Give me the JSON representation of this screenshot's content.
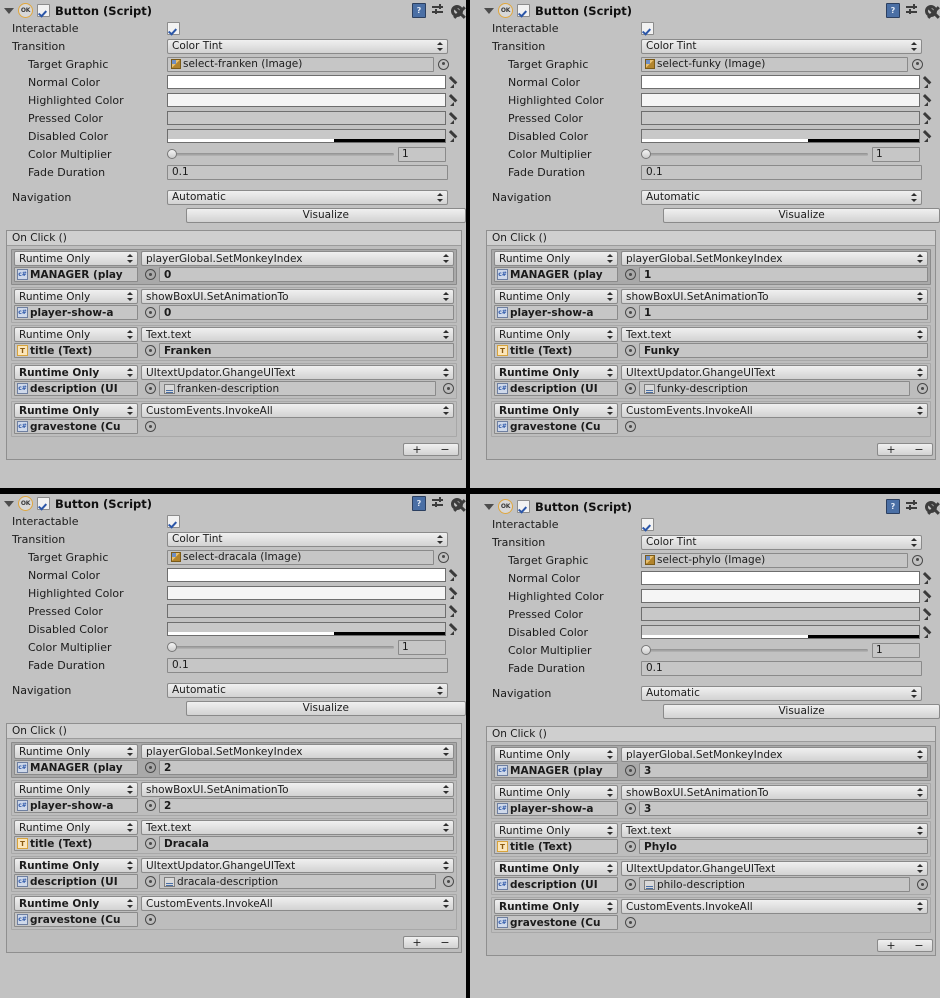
{
  "component": {
    "title": "Button (Script)",
    "badge": "OK",
    "enabled": true,
    "help_icon": "book-help-icon",
    "preset_icon": "preset-icon",
    "gear_icon": "gear-icon"
  },
  "labels": {
    "interactable": "Interactable",
    "transition": "Transition",
    "target_graphic": "Target Graphic",
    "normal_color": "Normal Color",
    "highlighted_color": "Highlighted Color",
    "pressed_color": "Pressed Color",
    "disabled_color": "Disabled Color",
    "color_multiplier": "Color Multiplier",
    "fade_duration": "Fade Duration",
    "navigation": "Navigation",
    "visualize": "Visualize",
    "on_click": "On Click ()",
    "plus": "+",
    "minus": "−"
  },
  "common": {
    "transition_value": "Color Tint",
    "navigation_value": "Automatic",
    "color_multiplier_value": "1",
    "fade_duration_value": "0.1",
    "normal_color_hex": "#ffffff",
    "highlighted_color_hex": "#f5f5f5",
    "pressed_color_hex": "#c8c8c8",
    "disabled_color_hex": "#c8c8c8",
    "disabled_alpha_pct": 60
  },
  "panels": [
    {
      "id": "franken",
      "target_graphic": "select-franken (Image)",
      "events": [
        {
          "mode": "Runtime Only",
          "mode_bold": false,
          "method": "playerGlobal.SetMonkeyIndex",
          "object": "MANAGER (play",
          "object_icon": "script-icon",
          "arg": "0",
          "arg_type": "number",
          "selected": true
        },
        {
          "mode": "Runtime Only",
          "mode_bold": false,
          "method": "showBoxUI.SetAnimationTo",
          "object": "player-show-a",
          "object_icon": "script-icon",
          "arg": "0",
          "arg_type": "number",
          "selected": false
        },
        {
          "mode": "Runtime Only",
          "mode_bold": false,
          "method": "Text.text",
          "object": "title (Text)",
          "object_icon": "text-icon",
          "arg": "Franken",
          "arg_type": "string",
          "selected": false
        },
        {
          "mode": "Runtime Only",
          "mode_bold": true,
          "method": "UItextUpdator.GhangeUIText",
          "object": "description (UI",
          "object_icon": "script-icon",
          "arg": "franken-description",
          "arg_type": "object",
          "selected": false
        },
        {
          "mode": "Runtime Only",
          "mode_bold": true,
          "method": "CustomEvents.InvokeAll",
          "object": "gravestone (Cu",
          "object_icon": "script-icon",
          "arg": "",
          "arg_type": "none",
          "selected": false
        }
      ]
    },
    {
      "id": "funky",
      "target_graphic": "select-funky (Image)",
      "events": [
        {
          "mode": "Runtime Only",
          "mode_bold": false,
          "method": "playerGlobal.SetMonkeyIndex",
          "object": "MANAGER (play",
          "object_icon": "script-icon",
          "arg": "1",
          "arg_type": "number",
          "selected": true
        },
        {
          "mode": "Runtime Only",
          "mode_bold": false,
          "method": "showBoxUI.SetAnimationTo",
          "object": "player-show-a",
          "object_icon": "script-icon",
          "arg": "1",
          "arg_type": "number",
          "selected": false
        },
        {
          "mode": "Runtime Only",
          "mode_bold": false,
          "method": "Text.text",
          "object": "title (Text)",
          "object_icon": "text-icon",
          "arg": "Funky",
          "arg_type": "string",
          "selected": false
        },
        {
          "mode": "Runtime Only",
          "mode_bold": true,
          "method": "UItextUpdator.GhangeUIText",
          "object": "description (UI",
          "object_icon": "script-icon",
          "arg": "funky-description",
          "arg_type": "object",
          "selected": false
        },
        {
          "mode": "Runtime Only",
          "mode_bold": true,
          "method": "CustomEvents.InvokeAll",
          "object": "gravestone (Cu",
          "object_icon": "script-icon",
          "arg": "",
          "arg_type": "none",
          "selected": false
        }
      ]
    },
    {
      "id": "dracala",
      "target_graphic": "select-dracala (Image)",
      "events": [
        {
          "mode": "Runtime Only",
          "mode_bold": false,
          "method": "playerGlobal.SetMonkeyIndex",
          "object": "MANAGER (play",
          "object_icon": "script-icon",
          "arg": "2",
          "arg_type": "number",
          "selected": true
        },
        {
          "mode": "Runtime Only",
          "mode_bold": false,
          "method": "showBoxUI.SetAnimationTo",
          "object": "player-show-a",
          "object_icon": "script-icon",
          "arg": "2",
          "arg_type": "number",
          "selected": false
        },
        {
          "mode": "Runtime Only",
          "mode_bold": false,
          "method": "Text.text",
          "object": "title (Text)",
          "object_icon": "text-icon",
          "arg": "Dracala",
          "arg_type": "string",
          "selected": false
        },
        {
          "mode": "Runtime Only",
          "mode_bold": true,
          "method": "UItextUpdator.GhangeUIText",
          "object": "description (UI",
          "object_icon": "script-icon",
          "arg": "dracala-description",
          "arg_type": "object",
          "selected": false
        },
        {
          "mode": "Runtime Only",
          "mode_bold": true,
          "method": "CustomEvents.InvokeAll",
          "object": "gravestone (Cu",
          "object_icon": "script-icon",
          "arg": "",
          "arg_type": "none",
          "selected": false
        }
      ]
    },
    {
      "id": "phylo",
      "target_graphic": "select-phylo (Image)",
      "events": [
        {
          "mode": "Runtime Only",
          "mode_bold": false,
          "method": "playerGlobal.SetMonkeyIndex",
          "object": "MANAGER (play",
          "object_icon": "script-icon",
          "arg": "3",
          "arg_type": "number",
          "selected": true
        },
        {
          "mode": "Runtime Only",
          "mode_bold": false,
          "method": "showBoxUI.SetAnimationTo",
          "object": "player-show-a",
          "object_icon": "script-icon",
          "arg": "3",
          "arg_type": "number",
          "selected": false
        },
        {
          "mode": "Runtime Only",
          "mode_bold": false,
          "method": "Text.text",
          "object": "title (Text)",
          "object_icon": "text-icon",
          "arg": "Phylo",
          "arg_type": "string",
          "selected": false
        },
        {
          "mode": "Runtime Only",
          "mode_bold": true,
          "method": "UItextUpdator.GhangeUIText",
          "object": "description (UI",
          "object_icon": "script-icon",
          "arg": "philo-description",
          "arg_type": "object",
          "selected": false
        },
        {
          "mode": "Runtime Only",
          "mode_bold": true,
          "method": "CustomEvents.InvokeAll",
          "object": "gravestone (Cu",
          "object_icon": "script-icon",
          "arg": "",
          "arg_type": "none",
          "selected": false
        }
      ]
    }
  ]
}
